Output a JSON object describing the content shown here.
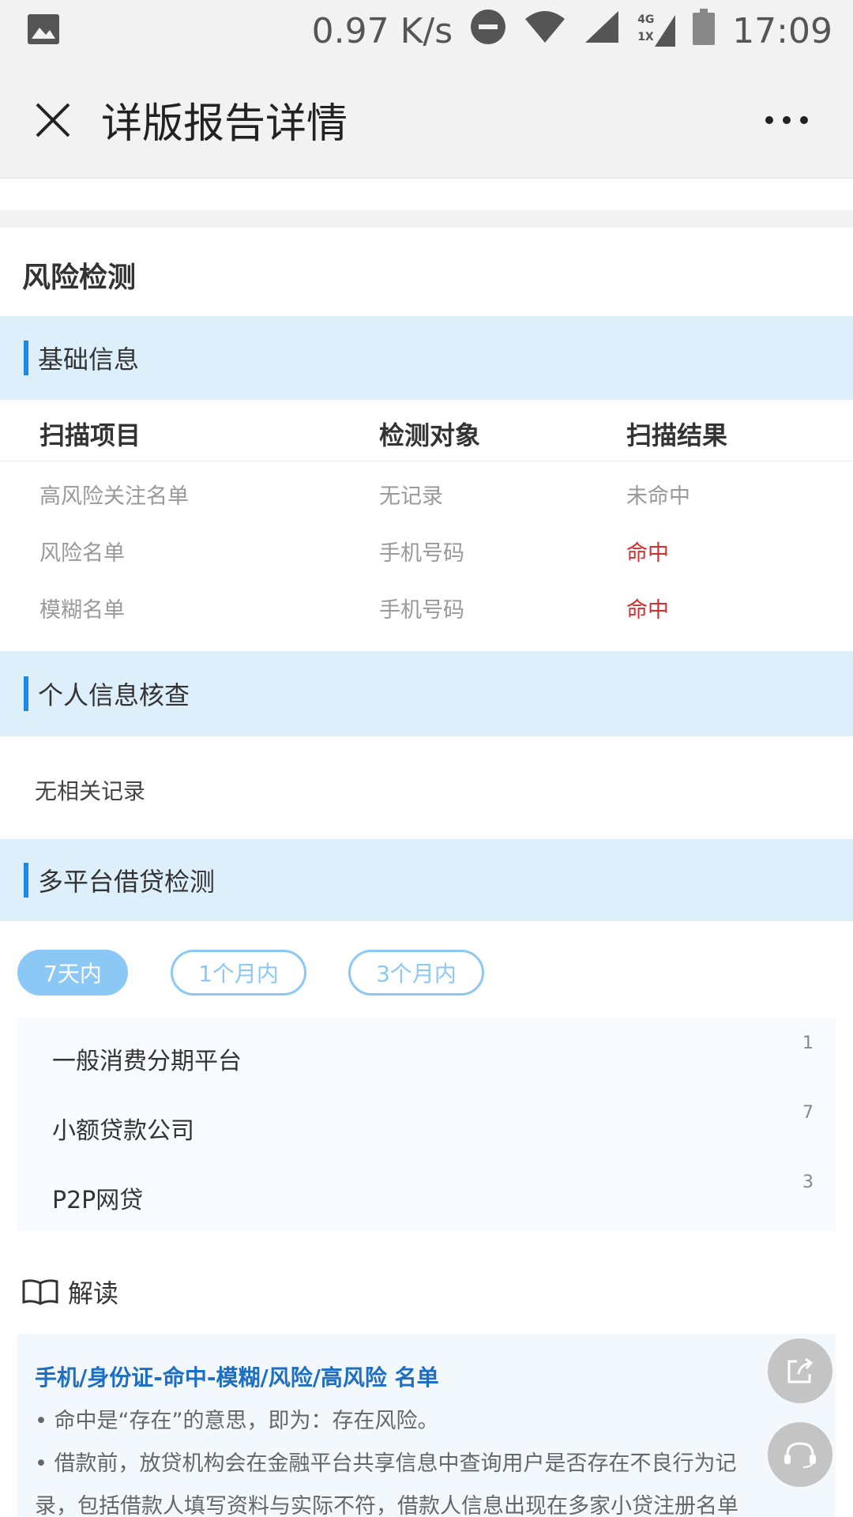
{
  "status_bar": {
    "net_speed": "0.97 K/s",
    "time": "17:09",
    "network_label_top": "4G",
    "network_label_bottom": "1X"
  },
  "app_bar": {
    "title": "详版报告详情"
  },
  "section": {
    "title": "风险检测"
  },
  "basic_info": {
    "heading": "基础信息",
    "columns": [
      "扫描项目",
      "检测对象",
      "扫描结果"
    ],
    "rows": [
      {
        "item": "高风险关注名单",
        "target": "无记录",
        "result": "未命中"
      },
      {
        "item": "风险名单",
        "target": "手机号码",
        "result": "命中"
      },
      {
        "item": "模糊名单",
        "target": "手机号码",
        "result": "命中"
      }
    ]
  },
  "personal_check": {
    "heading": "个人信息核查",
    "empty_text": "无相关记录"
  },
  "multi_platform": {
    "heading": "多平台借贷检测",
    "tabs": [
      "7天内",
      "1个月内",
      "3个月内"
    ],
    "active_tab": 0,
    "items": [
      {
        "name": "一般消费分期平台",
        "count": "1"
      },
      {
        "name": "小额贷款公司",
        "count": "7"
      },
      {
        "name": "P2P网贷",
        "count": "3"
      }
    ]
  },
  "interpretation": {
    "label": "解读",
    "heading": "手机/身份证-命中-模糊/风险/高风险 名单",
    "lines": [
      "• 命中是“存在”的意思，即为：存在风险。",
      "• 借款前，放贷机构会在金融平台共享信息中查询用户是否存在不良行为记",
      "录，包括借款人填写资料与实际不符，借款人信息出现在多家小贷注册名单"
    ]
  },
  "colors": {
    "accent": "#1e88e5",
    "band": "#deeffc",
    "hit": "#d32f2f",
    "pill": "#8cc8f5"
  }
}
